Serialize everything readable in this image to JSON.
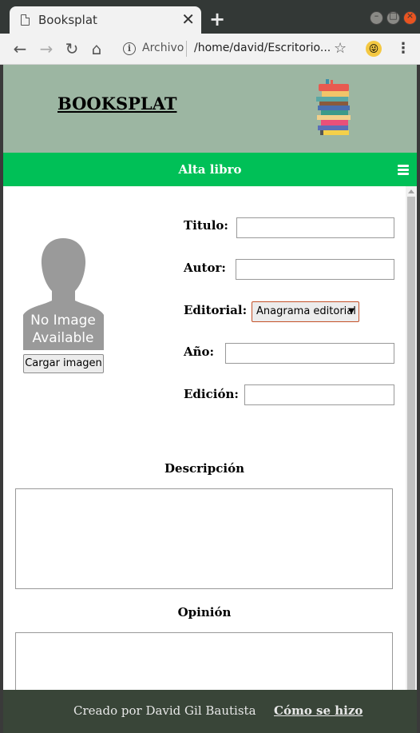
{
  "browser": {
    "tab_title": "Booksplat",
    "tab_close": "✕",
    "new_tab": "+",
    "address_label": "Archivo",
    "address_url": "/home/david/Escritorio..."
  },
  "header": {
    "site_title": "BOOKSPLAT"
  },
  "nav": {
    "title": "Alta libro"
  },
  "image_panel": {
    "placeholder_line1": "No Image",
    "placeholder_line2": "Available",
    "upload_label": "Cargar imagen"
  },
  "form": {
    "titulo_label": "Titulo:",
    "autor_label": "Autor:",
    "editorial_label": "Editorial:",
    "editorial_selected": "Anagrama editorial",
    "anio_label": "Año:",
    "edicion_label": "Edición:",
    "descripcion_label": "Descripción",
    "opinion_label": "Opinión"
  },
  "footer": {
    "credit": "Creado por David Gil Bautista",
    "link": "Cómo se hizo"
  },
  "colors": {
    "header_bg": "#9cb6a2",
    "nav_bg": "#00c057",
    "footer_bg": "#394538"
  }
}
